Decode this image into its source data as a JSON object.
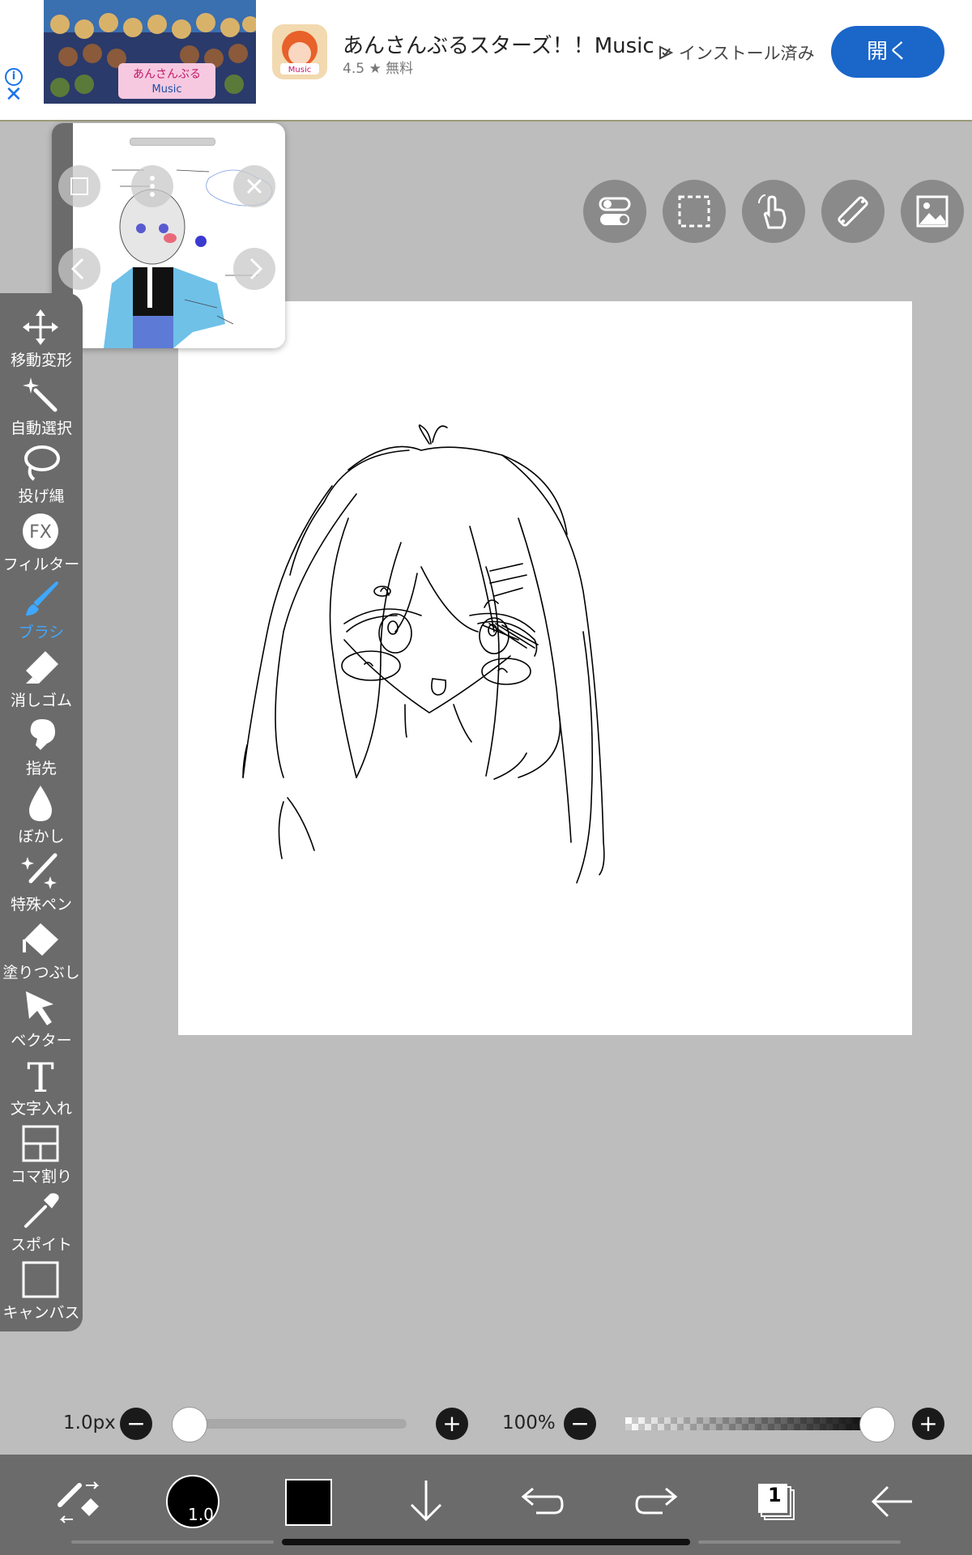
{
  "ad": {
    "title": "あんさんぶるスターズ！！Music",
    "rating": "4.5 ★  無料",
    "installed_label": "インストール済み",
    "open_button": "開く",
    "info_icon": "info-icon",
    "close_icon": "close-icon",
    "brand_color": "#1a66c9"
  },
  "toolbar": {
    "tools": [
      {
        "id": "move",
        "label": "移動変形",
        "icon": "move-icon"
      },
      {
        "id": "magic-wand",
        "label": "自動選択",
        "icon": "magic-wand-icon"
      },
      {
        "id": "lasso",
        "label": "投げ縄",
        "icon": "lasso-icon"
      },
      {
        "id": "filter",
        "label": "フィルター",
        "icon": "fx-icon"
      },
      {
        "id": "brush",
        "label": "ブラシ",
        "icon": "brush-icon",
        "active": true
      },
      {
        "id": "eraser",
        "label": "消しゴム",
        "icon": "eraser-icon"
      },
      {
        "id": "finger",
        "label": "指先",
        "icon": "finger-icon"
      },
      {
        "id": "blur",
        "label": "ぼかし",
        "icon": "blur-drop-icon"
      },
      {
        "id": "special-pen",
        "label": "特殊ペン",
        "icon": "special-pen-icon"
      },
      {
        "id": "fill",
        "label": "塗りつぶし",
        "icon": "bucket-icon"
      },
      {
        "id": "vector",
        "label": "ベクター",
        "icon": "vector-cursor-icon"
      },
      {
        "id": "text",
        "label": "文字入れ",
        "icon": "text-icon"
      },
      {
        "id": "frame",
        "label": "コマ割り",
        "icon": "frame-divide-icon"
      },
      {
        "id": "eyedropper",
        "label": "スポイト",
        "icon": "eyedropper-icon"
      },
      {
        "id": "canvas",
        "label": "キャンバス",
        "icon": "canvas-icon"
      }
    ],
    "active_color": "#3fa7ff"
  },
  "top_buttons": [
    "toggle-icon",
    "selection-rect-icon",
    "hand-gesture-icon",
    "ruler-icon",
    "image-icon"
  ],
  "sliders": {
    "brush_size": "1.0px",
    "brush_size_fraction": 0.0,
    "opacity": "100%",
    "opacity_fraction": 1.0
  },
  "bottom_bar": {
    "brush_badge": "1.0",
    "primary_color": "#000000",
    "layer_count": "1"
  }
}
